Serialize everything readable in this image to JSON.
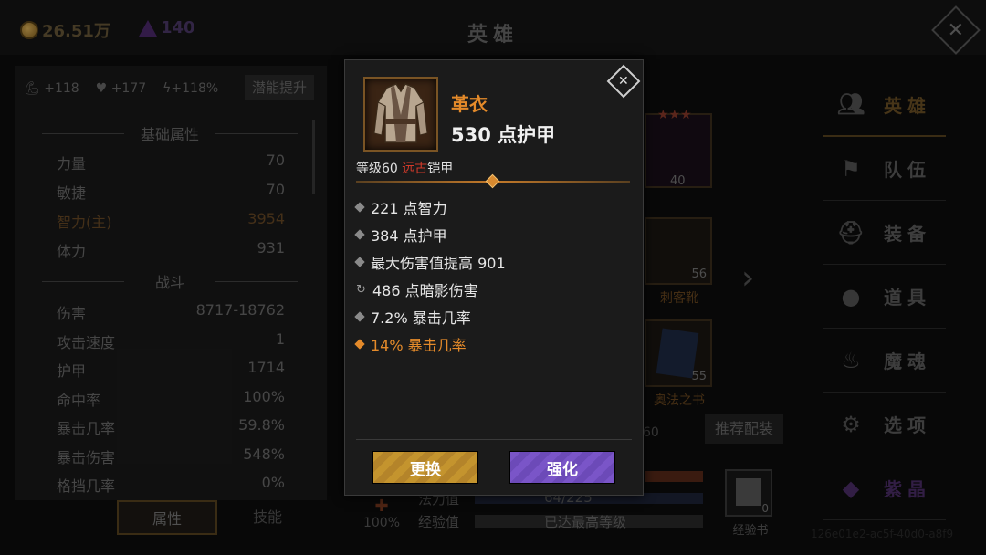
{
  "topbar": {
    "gold": "26.51万",
    "gems": "140",
    "title": "英雄"
  },
  "left_panel": {
    "stat_bonuses": [
      "+118",
      "+177",
      "+118%"
    ],
    "potential_button": "潜能提升",
    "basic_header": "基础属性",
    "basic": [
      {
        "label": "力量",
        "value": "70"
      },
      {
        "label": "敏捷",
        "value": "70"
      },
      {
        "label": "智力(主)",
        "value": "3954"
      },
      {
        "label": "体力",
        "value": "931"
      }
    ],
    "combat_header": "战斗",
    "combat": [
      {
        "label": "伤害",
        "value": "8717-18762"
      },
      {
        "label": "攻击速度",
        "value": "1"
      },
      {
        "label": "护甲",
        "value": "1714"
      },
      {
        "label": "命中率",
        "value": "100%"
      },
      {
        "label": "暴击几率",
        "value": "59.8%"
      },
      {
        "label": "暴击伤害",
        "value": "548%"
      },
      {
        "label": "格挡几率",
        "value": "0%"
      }
    ],
    "tabs": [
      "属性",
      "技能"
    ]
  },
  "equipment": {
    "slots": [
      {
        "level": "40",
        "name": ""
      },
      {
        "level": "56",
        "name": "刺客靴"
      },
      {
        "level": "55",
        "name": "奥法之书"
      }
    ],
    "partial_level": "60",
    "recommend_button": "推荐配装",
    "percent": "100%",
    "mana_label": "法力值",
    "mana_value": "64/225",
    "exp_label": "经验值",
    "exp_value": "已达最高等级",
    "exp_book_label": "经验书",
    "exp_book_count": "0"
  },
  "nav": [
    {
      "label": "英雄",
      "icon": "heroes-icon"
    },
    {
      "label": "队伍",
      "icon": "flag-icon"
    },
    {
      "label": "装备",
      "icon": "helmet-icon"
    },
    {
      "label": "道具",
      "icon": "bag-icon"
    },
    {
      "label": "魔魂",
      "icon": "flame-icon"
    },
    {
      "label": "选项",
      "icon": "gear-icon"
    },
    {
      "label": "紫晶",
      "icon": "amethyst-icon"
    }
  ],
  "watermark": "126e01e2-ac5f-40d0-a8f9",
  "modal": {
    "item_name": "革衣",
    "item_armor": "530 点护甲",
    "level_text": "等级60",
    "rarity": "远古",
    "type": "铠甲",
    "stats": [
      {
        "text": "221 点智力"
      },
      {
        "text": "384 点护甲"
      },
      {
        "text": "最大伤害值提高 901"
      },
      {
        "text": "486 点暗影伤害"
      },
      {
        "text": "7.2% 暴击几率"
      },
      {
        "text": "14% 暴击几率"
      }
    ],
    "replace_button": "更换",
    "upgrade_button": "强化"
  },
  "colors": {
    "accent_orange": "#e48a2a",
    "ancient_red": "#d03a2a",
    "gold_button": "#c4942e",
    "purple_button": "#7a55c8"
  }
}
